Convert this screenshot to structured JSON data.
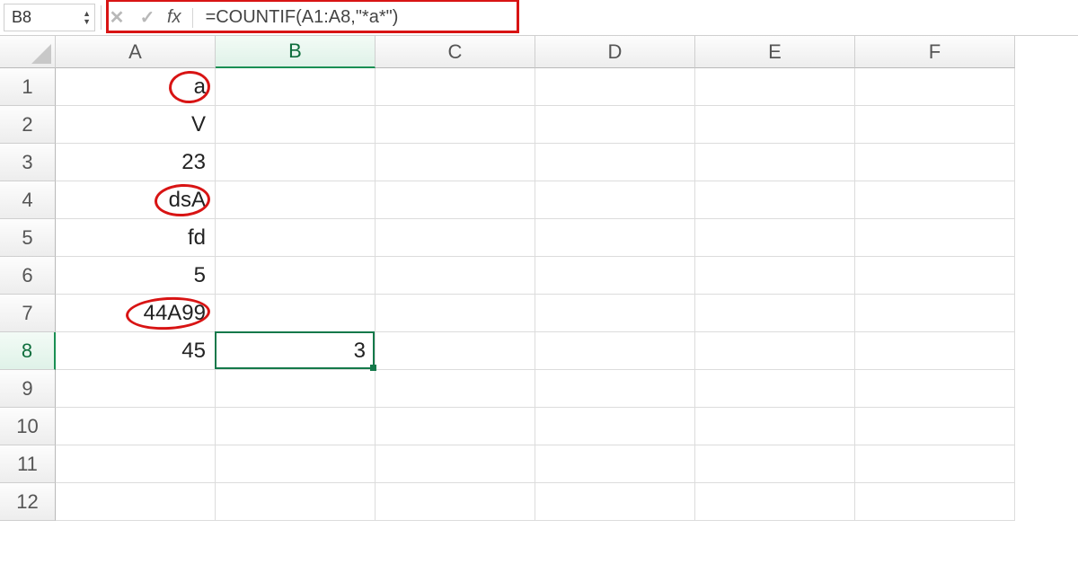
{
  "formula_bar": {
    "name_box": "B8",
    "formula": "=COUNTIF(A1:A8,\"*a*\")",
    "fx_label": "fx",
    "cancel_glyph": "✕",
    "confirm_glyph": "✓",
    "up_glyph": "▲",
    "down_glyph": "▼"
  },
  "columns": [
    "A",
    "B",
    "C",
    "D",
    "E",
    "F"
  ],
  "rows": [
    "1",
    "2",
    "3",
    "4",
    "5",
    "6",
    "7",
    "8",
    "9",
    "10",
    "11",
    "12"
  ],
  "selected_col_index": 1,
  "selected_row_index": 7,
  "cells": {
    "A1": "a",
    "A2": "V",
    "A3": "23",
    "A4": "dsA",
    "A5": "fd",
    "A6": "5",
    "A7": "44A99",
    "A8": "45",
    "B8": "3"
  },
  "active_cell": "B8",
  "annotations": {
    "circled_cells": [
      "A1",
      "A4",
      "A7"
    ]
  },
  "chart_data": {
    "type": "table",
    "columns": [
      "A",
      "B"
    ],
    "rows": [
      {
        "row": 1,
        "A": "a",
        "B": ""
      },
      {
        "row": 2,
        "A": "V",
        "B": ""
      },
      {
        "row": 3,
        "A": "23",
        "B": ""
      },
      {
        "row": 4,
        "A": "dsA",
        "B": ""
      },
      {
        "row": 5,
        "A": "fd",
        "B": ""
      },
      {
        "row": 6,
        "A": "5",
        "B": ""
      },
      {
        "row": 7,
        "A": "44A99",
        "B": ""
      },
      {
        "row": 8,
        "A": "45",
        "B": "3"
      }
    ],
    "formula_in_B8": "=COUNTIF(A1:A8,\"*a*\")",
    "notes": "Red-circled cells A1,A4,A7 are the three matches counted by the formula"
  }
}
